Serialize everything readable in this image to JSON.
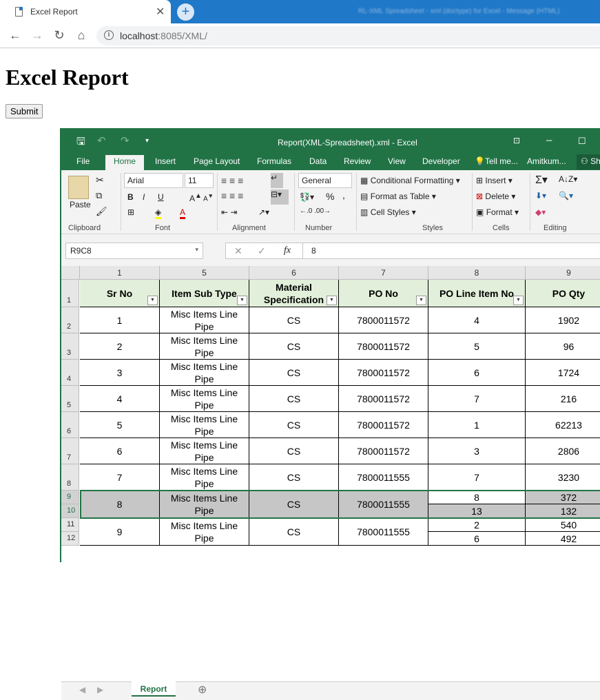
{
  "browser": {
    "tab_title": "Excel Report",
    "tab_close": "✕",
    "new_tab": "+",
    "window_title_blurred": "RL-XML Spreadsheet - xml (doctype) for Excel - Message (HTML)",
    "address_host": "localhost",
    "address_rest": ":8085/XML/"
  },
  "page": {
    "title": "Excel Report",
    "submit_label": "Submit"
  },
  "excel": {
    "window_title": "Report(XML-Spreadsheet).xml - Excel",
    "ribbon_tabs": [
      "File",
      "Home",
      "Insert",
      "Page Layout",
      "Formulas",
      "Data",
      "Review",
      "View",
      "Developer",
      "Tell me...",
      "Amitkum...",
      "Sh"
    ],
    "clipboard": {
      "paste": "Paste",
      "label": "Clipboard"
    },
    "font": {
      "name": "Arial",
      "size": "11",
      "bold": "B",
      "italic": "I",
      "underline": "U",
      "label": "Font"
    },
    "alignment": {
      "label": "Alignment"
    },
    "number": {
      "format": "General",
      "percent": "%",
      "comma": ",",
      "label": "Number"
    },
    "styles": {
      "conditional": "Conditional Formatting",
      "format_table": "Format as Table",
      "cell_styles": "Cell Styles",
      "label": "Styles"
    },
    "cells": {
      "insert": "Insert",
      "delete": "Delete",
      "format": "Format",
      "label": "Cells"
    },
    "editing": {
      "label": "Editing"
    },
    "name_box": "R9C8",
    "formula_value": "8",
    "column_headers": [
      "1",
      "5",
      "6",
      "7",
      "8",
      "9"
    ],
    "row_headers": [
      "1",
      "2",
      "3",
      "4",
      "5",
      "6",
      "7",
      "8",
      "9",
      "10",
      "11",
      "12"
    ],
    "table_headers": [
      "Sr No",
      "Item Sub Type",
      "Material Specification",
      "PO No",
      "PO Line Item No",
      "PO Qty"
    ],
    "rows": [
      {
        "sr": "1",
        "item": "Misc Items Line Pipe",
        "mat": "CS",
        "po": "7800011572",
        "line": "4",
        "qty": "1902"
      },
      {
        "sr": "2",
        "item": "Misc Items Line Pipe",
        "mat": "CS",
        "po": "7800011572",
        "line": "5",
        "qty": "96"
      },
      {
        "sr": "3",
        "item": "Misc Items Line Pipe",
        "mat": "CS",
        "po": "7800011572",
        "line": "6",
        "qty": "1724"
      },
      {
        "sr": "4",
        "item": "Misc Items Line Pipe",
        "mat": "CS",
        "po": "7800011572",
        "line": "7",
        "qty": "216"
      },
      {
        "sr": "5",
        "item": "Misc Items Line Pipe",
        "mat": "CS",
        "po": "7800011572",
        "line": "1",
        "qty": "62213"
      },
      {
        "sr": "6",
        "item": "Misc Items Line Pipe",
        "mat": "CS",
        "po": "7800011572",
        "line": "3",
        "qty": "2806"
      },
      {
        "sr": "7",
        "item": "Misc Items Line Pipe",
        "mat": "CS",
        "po": "7800011555",
        "line": "7",
        "qty": "3230"
      }
    ],
    "merged_rows": [
      {
        "sr": "8",
        "item": "Misc Items Line Pipe",
        "mat": "CS",
        "po": "7800011555",
        "lines": [
          "8",
          "13"
        ],
        "qtys": [
          "372",
          "132"
        ]
      },
      {
        "sr": "9",
        "item": "Misc Items Line Pipe",
        "mat": "CS",
        "po": "7800011555",
        "lines": [
          "2",
          "6"
        ],
        "qtys": [
          "540",
          "492"
        ]
      }
    ],
    "sheet_tab": "Report",
    "accent_color": "#217346"
  }
}
